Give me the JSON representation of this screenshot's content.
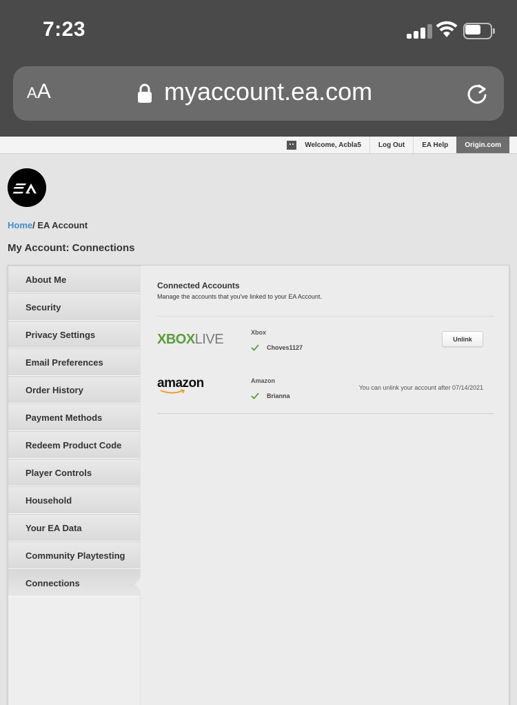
{
  "status_bar": {
    "time": "7:23"
  },
  "browser": {
    "text_size_label_small": "A",
    "text_size_label_large": "A",
    "url": "myaccount.ea.com"
  },
  "top_nav": {
    "welcome": "Welcome, Acbla5",
    "logout": "Log Out",
    "help": "EA Help",
    "origin": "Origin.com"
  },
  "breadcrumb": {
    "home": "Home",
    "separator": "/",
    "current": "EA Account"
  },
  "page_title": "My Account: Connections",
  "sidebar": {
    "items": [
      {
        "label": "About Me"
      },
      {
        "label": "Security"
      },
      {
        "label": "Privacy Settings"
      },
      {
        "label": "Email Preferences"
      },
      {
        "label": "Order History"
      },
      {
        "label": "Payment Methods"
      },
      {
        "label": "Redeem Product Code"
      },
      {
        "label": "Player Controls"
      },
      {
        "label": "Household"
      },
      {
        "label": "Your EA Data"
      },
      {
        "label": "Community Playtesting"
      },
      {
        "label": "Connections"
      }
    ]
  },
  "connected": {
    "title": "Connected Accounts",
    "subtitle": "Manage the accounts that you've linked to your EA Account.",
    "accounts": [
      {
        "service": "Xbox",
        "logo_text_a": "XBOX",
        "logo_text_b": "LIVE",
        "username": "Choves1127",
        "action": "Unlink"
      },
      {
        "service": "Amazon",
        "logo_text": "amazon",
        "username": "Brianna",
        "note": "You can unlink your account after 07/14/2021"
      }
    ]
  },
  "colors": {
    "accent": "#3b8fcf",
    "check": "#5a9e3a",
    "ios_chrome": "#4a4a4a"
  }
}
